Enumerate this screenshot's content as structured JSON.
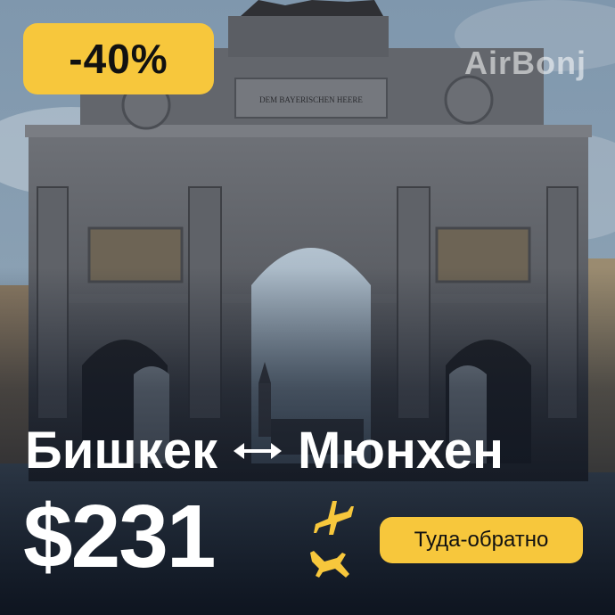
{
  "discount": {
    "label": "-40%"
  },
  "brand": {
    "name": "AirBonj"
  },
  "monument": {
    "inscription": "DEM BAYERISCHEN HEERE"
  },
  "route": {
    "from": "Бишкек",
    "to": "Мюнхен",
    "arrow_icon": "bidirectional-arrow-icon"
  },
  "price": {
    "value": "$231",
    "icon": "airplane-takeoff-landing-icon"
  },
  "trip": {
    "label": "Туда-обратно"
  },
  "colors": {
    "accent": "#f7c73c",
    "text": "#ffffff",
    "dark": "#111111"
  }
}
